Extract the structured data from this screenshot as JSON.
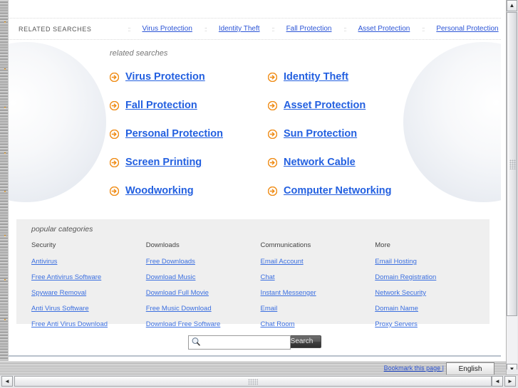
{
  "top_strip": {
    "label": "RELATED SEARCHES",
    "separator": "::",
    "links": [
      "Virus Protection",
      "Identity Theft",
      "Fall Protection",
      "Asset Protection",
      "Personal Protection"
    ]
  },
  "related": {
    "heading": "related searches",
    "items": [
      "Virus Protection",
      "Identity Theft",
      "Fall Protection",
      "Asset Protection",
      "Personal Protection",
      "Sun Protection",
      "Screen Printing",
      "Network Cable",
      "Woodworking",
      "Computer Networking"
    ]
  },
  "categories": {
    "title": "popular categories",
    "columns": [
      {
        "head": "Security",
        "links": [
          "Antivirus",
          "Free Antivirus Software",
          "Spyware Removal",
          "Anti Virus Software",
          "Free Anti Virus Download"
        ]
      },
      {
        "head": "Downloads",
        "links": [
          "Free Downloads",
          "Download Music",
          "Download Full Movie",
          "Free Music Download",
          "Download Free Software"
        ]
      },
      {
        "head": "Communications",
        "links": [
          "Email Account",
          "Chat",
          "Instant Messenger",
          "Email",
          "Chat Room"
        ]
      },
      {
        "head": "More",
        "links": [
          "Email Hosting",
          "Domain Registration",
          "Network Security",
          "Domain Name",
          "Proxy Servers"
        ]
      }
    ]
  },
  "search": {
    "value": "",
    "placeholder": "",
    "button_label": "Search",
    "icon": "magnifier-icon"
  },
  "bottom_bar": {
    "bookmark_label": "Bookmark this page |",
    "language_value": "English"
  },
  "scrollbars": {
    "up_glyph": "▲",
    "down_glyph": "▼",
    "left_glyph": "◄",
    "right_glyph": "►"
  },
  "colors": {
    "link_blue": "#2360e0",
    "small_link_blue": "#3b6fe0",
    "arrow_orange": "#ef8a12",
    "panel_gray": "#efefef"
  }
}
